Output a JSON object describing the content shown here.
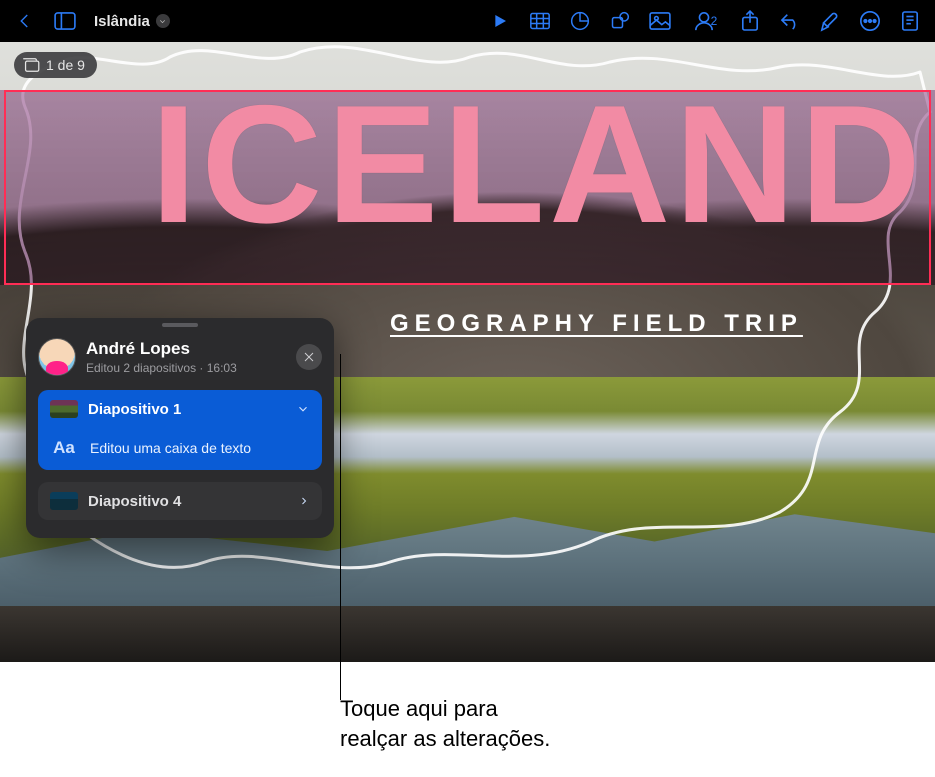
{
  "toolbar": {
    "doc_title": "Islândia",
    "collab_count": "2"
  },
  "slide_counter": "1 de 9",
  "slide": {
    "title": "ICELAND",
    "subtitle": "GEOGRAPHY FIELD TRIP"
  },
  "popover": {
    "user_name": "André Lopes",
    "meta_edits": "Editou 2 diapositivos",
    "meta_time": "16:03",
    "groups": [
      {
        "label": "Diapositivo 1",
        "expanded": true,
        "change_icon": "Aa",
        "change_desc": "Editou uma caixa de texto"
      },
      {
        "label": "Diapositivo 4",
        "expanded": false
      }
    ]
  },
  "callout": {
    "line1": "Toque aqui para",
    "line2": "realçar as alterações."
  }
}
